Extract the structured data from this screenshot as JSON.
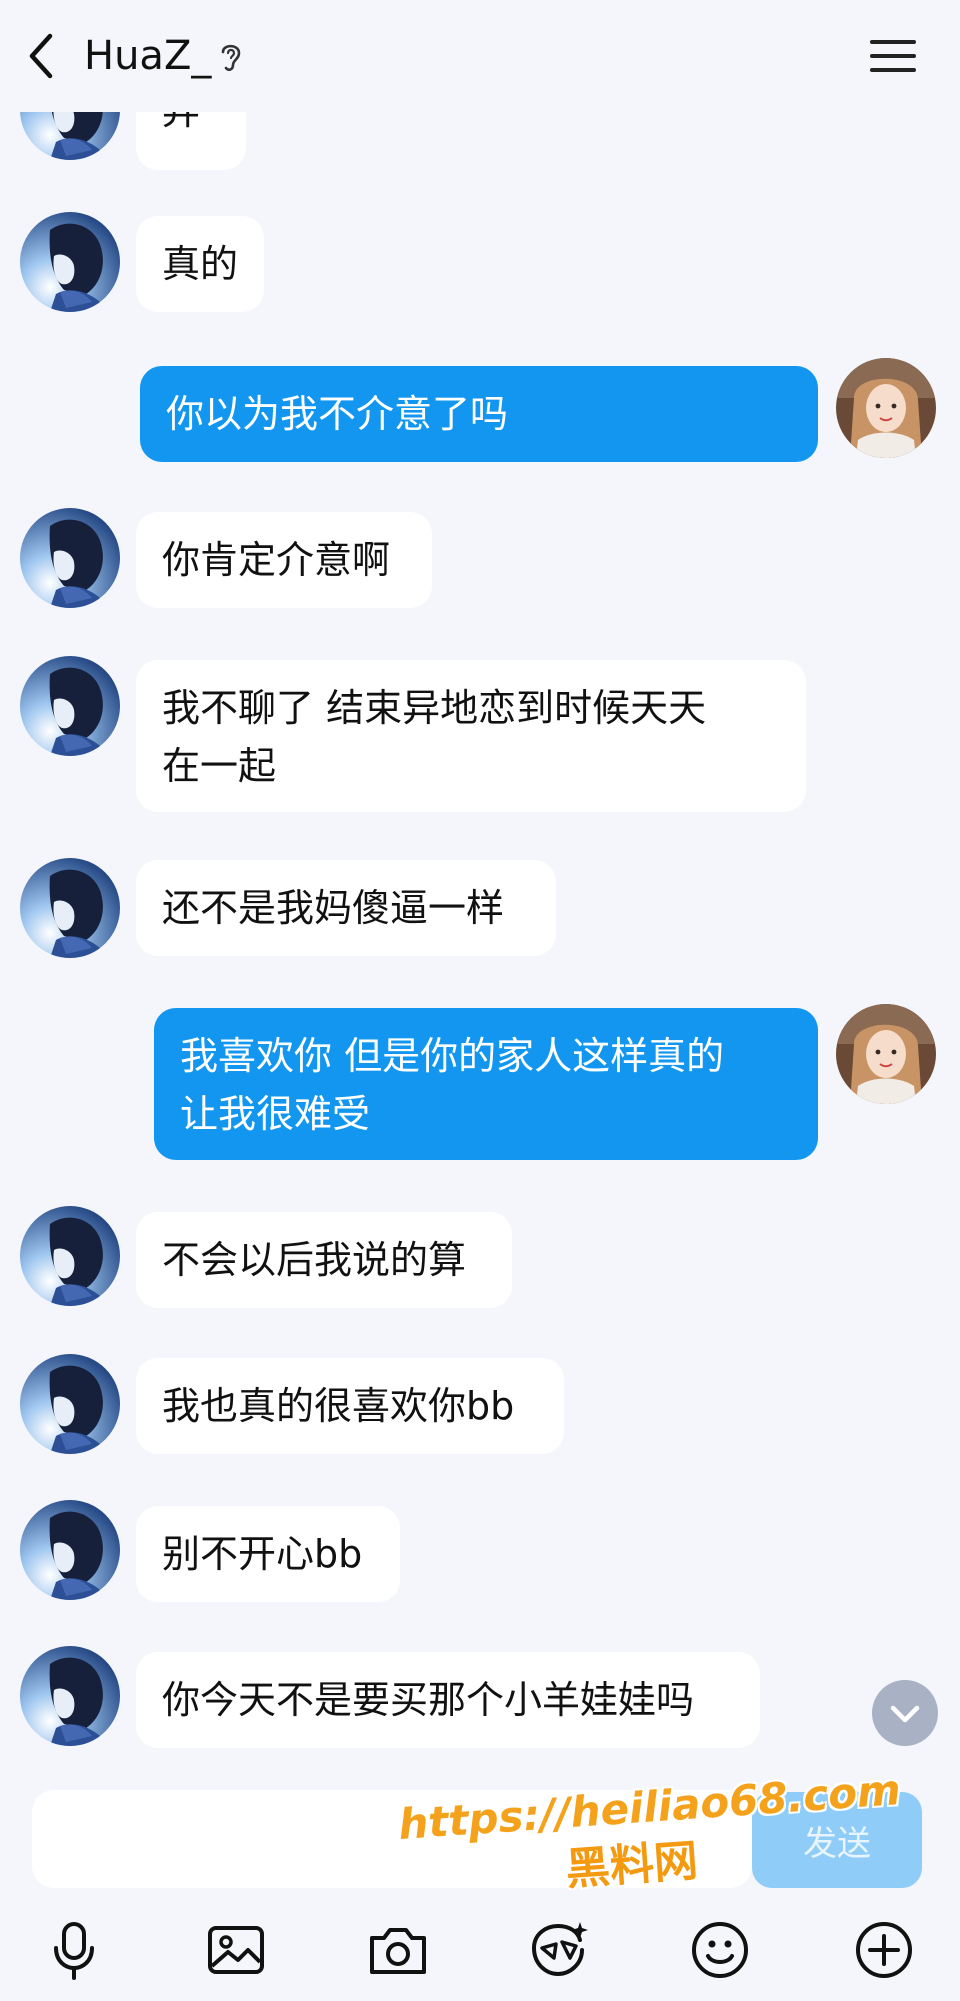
{
  "header": {
    "back_icon": "chevron-left-icon",
    "title": "HuaZ_",
    "ear_icon": "ear-icon",
    "menu_icon": "hamburger-menu-icon"
  },
  "messages": [
    {
      "side": "in",
      "text": "弃"
    },
    {
      "side": "in",
      "text": "真的"
    },
    {
      "side": "out",
      "text": "你以为我不介意了吗"
    },
    {
      "side": "in",
      "text": "你肯定介意啊"
    },
    {
      "side": "in",
      "text": "我不聊了 结束异地恋到时候天天\n在一起"
    },
    {
      "side": "in",
      "text": "还不是我妈傻逼一样"
    },
    {
      "side": "out",
      "text": "我喜欢你 但是你的家人这样真的\n让我很难受"
    },
    {
      "side": "in",
      "text": "不会以后我说的算"
    },
    {
      "side": "in",
      "text": "我也真的很喜欢你bb"
    },
    {
      "side": "in",
      "text": "别不开心bb"
    },
    {
      "side": "in",
      "text": "你今天不是要买那个小羊娃娃吗"
    }
  ],
  "scroll_down_icon": "chevron-down-icon",
  "composer": {
    "placeholder": "",
    "send_label": "发送"
  },
  "toolbar": [
    "microphone-icon",
    "image-icon",
    "camera-icon",
    "sticker-icon",
    "emoji-icon",
    "plus-icon"
  ],
  "watermark": {
    "url": "https://heiliao68.com",
    "site": "黑料网"
  },
  "colors": {
    "background": "#f4f6fb",
    "incoming_bubble": "#ffffff",
    "outgoing_bubble": "#1296f0",
    "send_button": "#8fcdf8",
    "watermark": "#f4a21c"
  }
}
